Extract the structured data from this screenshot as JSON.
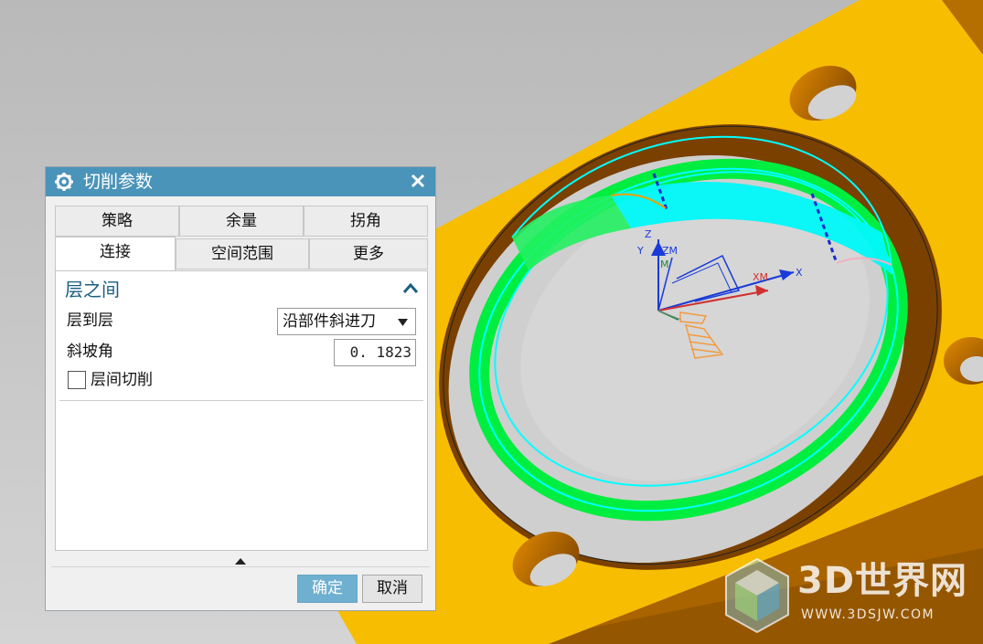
{
  "dialog": {
    "title": "切削参数",
    "tabs_row1": [
      "策略",
      "余量",
      "拐角"
    ],
    "tabs_row2": [
      "连接",
      "空间范围",
      "更多"
    ],
    "active_tab": "连接",
    "section_title": "层之间",
    "layer_to_layer_label": "层到层",
    "layer_to_layer_value": "沿部件斜进刀",
    "ramp_angle_label": "斜坡角",
    "ramp_angle_value": "0. 1823",
    "between_layers_cut_label": "层间切削",
    "between_layers_cut_checked": false,
    "ok_label": "确定",
    "cancel_label": "取消"
  },
  "viewport": {
    "axis_labels": {
      "z": "Z",
      "y": "Y",
      "zm": "ZM",
      "m": "M",
      "xm": "XM",
      "x": "X"
    },
    "colors": {
      "part": "#f5bc00",
      "part_dark": "#b26c00",
      "toolpath_green": "#00f043",
      "toolpath_cyan": "#00ffff",
      "background": "#c9c9c9"
    }
  },
  "watermark": {
    "brand": "3D世界网",
    "url": "WWW.3DSJW.COM"
  },
  "icons": [
    "gear-icon",
    "close-icon",
    "collapse-up-icon",
    "dropdown-caret-icon",
    "expand-arrow-icon",
    "3dsjw-logo-icon"
  ]
}
